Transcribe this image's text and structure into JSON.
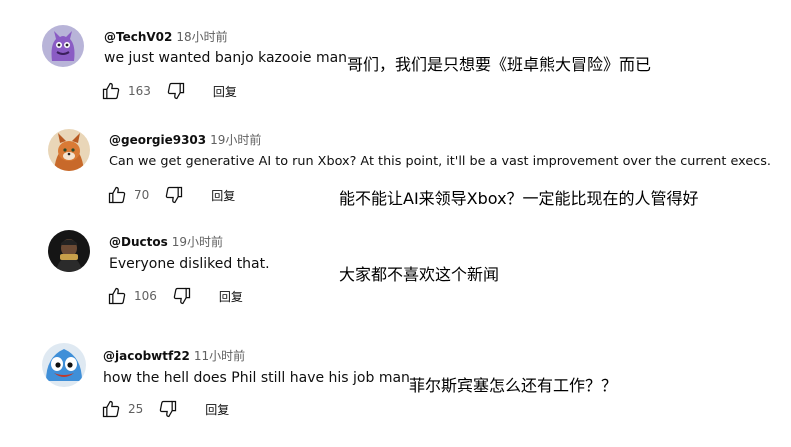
{
  "comments": [
    {
      "handle": "@TechV02",
      "time": "18小时前",
      "text": "we just wanted banjo kazooie man",
      "likes": "163",
      "reply_label": "回复",
      "translation": "哥们，我们是只想要《班卓熊大冒险》而已",
      "avatar_icon": "purple-creature-avatar"
    },
    {
      "handle": "@georgie9303",
      "time": "19小时前",
      "text": "Can we get generative AI to run Xbox? At this point, it'll be a vast improvement over the current execs.",
      "likes": "70",
      "reply_label": "回复",
      "translation": "能不能让AI来领导Xbox？一定能比现在的人管得好",
      "avatar_icon": "fox-character-avatar"
    },
    {
      "handle": "@Ductos",
      "time": "19小时前",
      "text": "Everyone disliked that.",
      "likes": "106",
      "reply_label": "回复",
      "translation": "大家都不喜欢这个新闻",
      "avatar_icon": "dark-photo-avatar"
    },
    {
      "handle": "@jacobwtf22",
      "time": "11小时前",
      "text": "how the hell does Phil still have his job man",
      "likes": "25",
      "reply_label": "回复",
      "translation": "菲尔斯宾塞怎么还有工作？？",
      "avatar_icon": "blue-slime-avatar"
    }
  ],
  "colors": {
    "text_primary": "#0f0f0f",
    "text_secondary": "#606060",
    "background": "#ffffff"
  }
}
